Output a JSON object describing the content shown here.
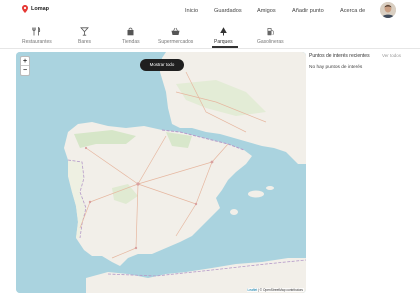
{
  "header": {
    "brand": "Lomap",
    "nav": [
      {
        "label": "Inicio"
      },
      {
        "label": "Guardados"
      },
      {
        "label": "Amigos"
      },
      {
        "label": "Añadir punto"
      },
      {
        "label": "Acerca de"
      }
    ]
  },
  "categories": [
    {
      "label": "Restaurantes",
      "icon": "cutlery-icon"
    },
    {
      "label": "Bares",
      "icon": "cocktail-glass-icon"
    },
    {
      "label": "Tiendas",
      "icon": "shopping-bag-icon"
    },
    {
      "label": "Supermercados",
      "icon": "shopping-basket-icon"
    },
    {
      "label": "Parques",
      "icon": "tree-icon",
      "active": true
    },
    {
      "label": "Gasolineras",
      "icon": "fuel-pump-icon"
    }
  ],
  "map": {
    "show_all_label": "Mostrar todo",
    "zoom_in": "+",
    "zoom_out": "−",
    "attribution_leaflet": "Leaflet",
    "attribution_rest": " | © OpenStreetMap contributors"
  },
  "sidebar": {
    "title": "Puntos de interés recientes",
    "view_all": "Ver todos",
    "empty": "No hay puntos de interés"
  },
  "colors": {
    "accent": "#1f1f1f",
    "brand_pin": "#e53935",
    "sea": "#aad3df",
    "land": "#f2efe9"
  }
}
